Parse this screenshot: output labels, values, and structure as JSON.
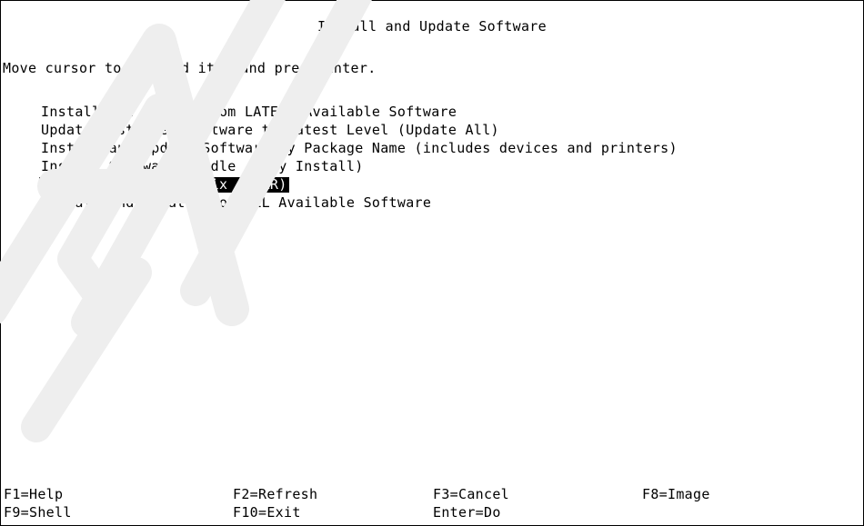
{
  "screen": {
    "title": "Install and Update Software",
    "instruction": "Move cursor to desired item and press Enter."
  },
  "menu": {
    "items": [
      {
        "label": "Install and Update from LATEST Available Software",
        "selected": false
      },
      {
        "label": "Update Installed Software to Latest Level (Update All)",
        "selected": false
      },
      {
        "label": "Install and Update Software by Package Name (includes devices and printers)",
        "selected": false
      },
      {
        "label": "Install Software Bundle (Easy Install)",
        "selected": false
      },
      {
        "label": "Update Software by Fix (APAR)",
        "selected": true
      },
      {
        "label": "Install and Update from ALL Available Software",
        "selected": false
      }
    ]
  },
  "function_keys": {
    "row1": [
      "F1=Help",
      "F2=Refresh",
      "F3=Cancel",
      "F8=Image"
    ],
    "row2": [
      "F9=Shell",
      "F10=Exit",
      "Enter=Do"
    ]
  },
  "colors": {
    "background": "#ffffff",
    "text": "#000000",
    "highlight_bg": "#000000",
    "highlight_text": "#ffffff",
    "watermark": "#eeeeee"
  }
}
